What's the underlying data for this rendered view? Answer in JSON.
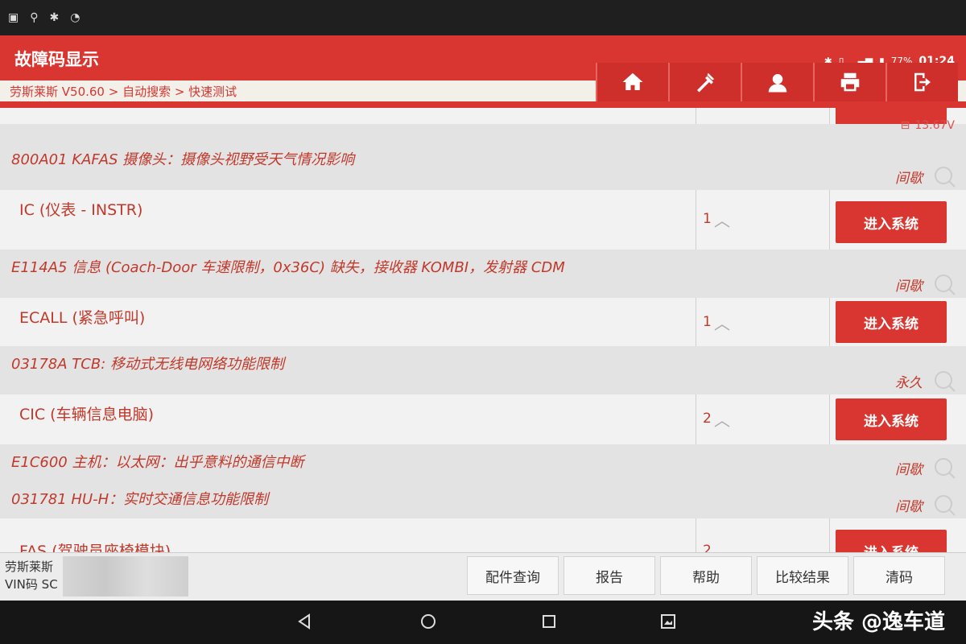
{
  "statusbar": {
    "battery": "77%",
    "time": "01:24"
  },
  "header": {
    "title": "故障码显示",
    "breadcrumb": "劳斯莱斯 V50.60 > 自动搜索 > 快速测试",
    "nav_icons": [
      "home-icon",
      "diagnose-icon",
      "support-icon",
      "print-icon",
      "exit-icon"
    ]
  },
  "voltage": "13.67V",
  "systems": [
    {
      "name": "IC (仪表 - INSTR)",
      "count": "1",
      "button": "进入系统",
      "codes": [
        {
          "code": "E114A5 信息 (Coach-Door 车速限制，0x36C) 缺失，接收器 KOMBI，发射器 CDM",
          "status": "间歇"
        }
      ]
    },
    {
      "name": "ECALL (紧急呼叫)",
      "count": "1",
      "button": "进入系统",
      "codes": [
        {
          "code": "03178A TCB: 移动式无线电网络功能限制",
          "status": "永久"
        }
      ]
    },
    {
      "name": "CIC (车辆信息电脑)",
      "count": "2",
      "button": "进入系统",
      "codes": [
        {
          "code": "E1C600 主机：以太网：出乎意料的通信中断",
          "status": "间歇"
        },
        {
          "code": "031781 HU-H：实时交通信息功能限制",
          "status": "间歇"
        }
      ]
    }
  ],
  "top_code": {
    "code": "800A01 KAFAS 摄像头：摄像头视野受天气情况影响",
    "status": "间歇"
  },
  "partial_system": {
    "name": "FAS (驾驶员座椅模块)",
    "count": "2",
    "button": "进入系统"
  },
  "bottombar": {
    "vehicle_brand": "劳斯莱斯",
    "vin_label": "VIN码 SC",
    "buttons": [
      "配件查询",
      "报告",
      "帮助",
      "比较结果",
      "清码"
    ]
  },
  "watermark": "头条 @逸车道"
}
